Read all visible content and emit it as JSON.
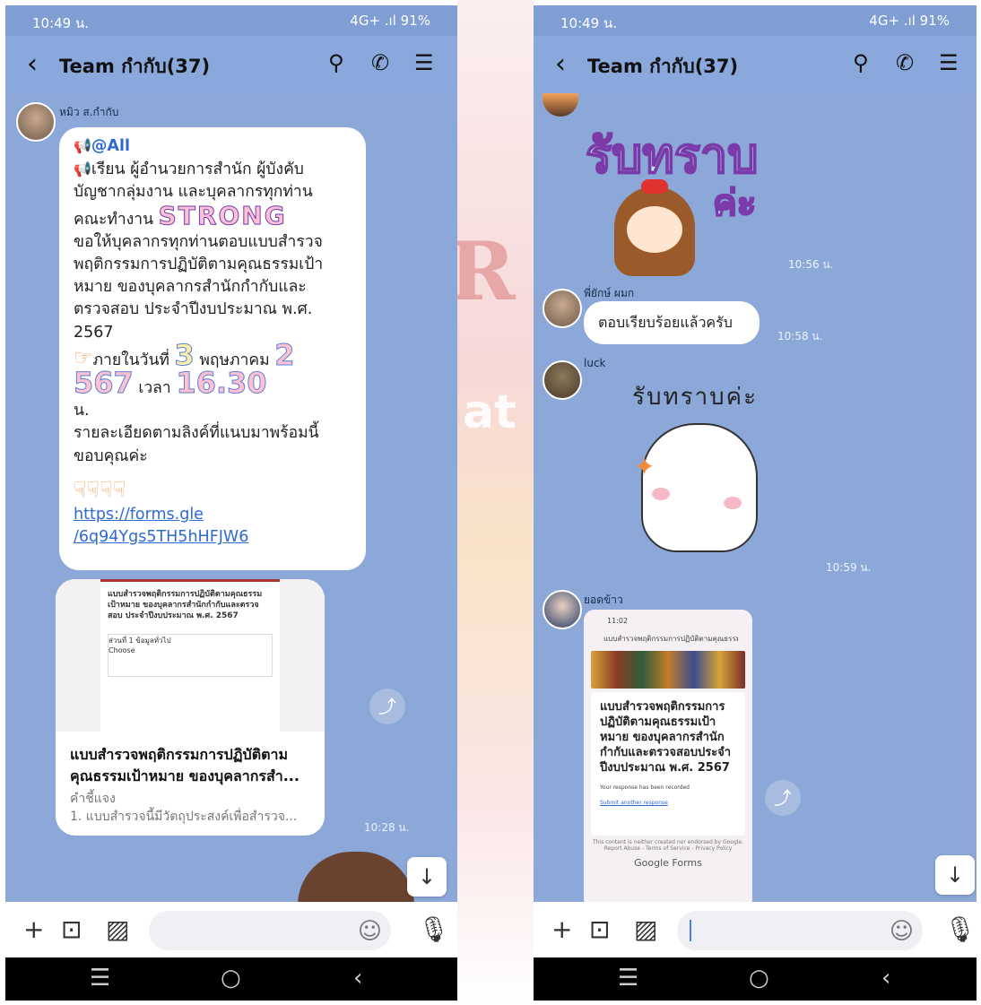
{
  "screens": [
    {
      "status": {
        "time": "10:49 น.",
        "right": "4G+ .ıl  91%"
      },
      "header": {
        "title": "Team กำกับ(37)"
      },
      "message1": {
        "sender": "หมิว ส.กำกับ",
        "mention": "@All",
        "line1": "เรียน ผู้อำนวยการสำนัก ผู้บังคับ",
        "line2": "บัญชากลุ่มงาน และบุคลากรทุกท่าน",
        "line3_prefix": "คณะทำงาน",
        "line3_strong": "STRONG",
        "line4": "ขอให้บุคลากรทุกท่านตอบแบบสำรวจ",
        "line5": "พฤติกรรมการปฏิบัติตามคุณธรรมเป้า",
        "line6": "หมาย ของบุคลากรสำนักกำกับและ",
        "line7": "ตรวจสอบ ประจำปีงบประมาณ พ.ศ.",
        "line8": "2567",
        "deadline_prefix": "ภายในวันที่",
        "deadline_day": "3",
        "deadline_month": "พฤษภาคม",
        "deadline_year1": "2",
        "deadline_year2": "567",
        "deadline_time_label": "เวลา",
        "deadline_time": "16.30",
        "deadline_unit": "น.",
        "line_detail": "รายละเอียดตามลิงค์ที่แนบมาพร้อมนี้",
        "line_thanks": "ขอบคุณค่ะ",
        "link_line1": "https://forms.gle",
        "link_line2": "/6q94Ygs5TH5hHFJW6"
      },
      "card": {
        "title_line1": "แบบสำรวจพฤติกรรมการปฏิบัติตาม",
        "title_line2": "คุณธรรมเป้าหมาย ของบุคลากรสำ...",
        "subtitle": "คำชี้แจง",
        "desc": "1. แบบสำรวจนี้มีวัตถุประสงค์เพื่อสำรวจ...",
        "time": "10:28 น.",
        "preview_title": "แบบสำรวจพฤติกรรมการปฏิบัติตามคุณธรรมเป้าหมาย ของบุคลากรสำนักกำกับและตรวจสอบ ประจำปีงบประมาณ พ.ศ. 2567",
        "preview_section": "ส่วนที่ 1 ข้อมูลทั่วไป",
        "preview_choose": "Choose"
      }
    },
    {
      "status": {
        "time": "10:49 น.",
        "right": "4G+ .ıl  91%"
      },
      "header": {
        "title": "Team กำกับ(37)"
      },
      "sticker1": {
        "word": "รับทราบ",
        "word2": "ค่ะ",
        "time": "10:56 น."
      },
      "message2": {
        "sender": "พี่ยักษ์ ผมก",
        "text": "ตอบเรียบร้อยแล้วครับ",
        "time": "10:58 น."
      },
      "sticker2": {
        "sender": "luck",
        "word": "รับทราบค่ะ",
        "time": "10:59 น."
      },
      "message3": {
        "sender": "ยอดข้าว",
        "shot_time": "11:02",
        "shot_bar": "แบบสำรวจพฤติกรรมการปฏิบัติตามคุณธรรมเป้าห...",
        "shot_title": "แบบสำรวจพฤติกรรมการปฏิบัติตามคุณธรรมเป้าหมาย ของบุคลากรสำนักกำกับและตรวจสอบประจำปีงบประมาณ พ.ศ. 2567",
        "shot_resp": "Your response has been recorded",
        "shot_submit": "Submit another response",
        "shot_foot": "This content is neither created nor endorsed by Google. Report Abuse - Terms of Service - Privacy Policy",
        "shot_gf": "Google Forms"
      }
    }
  ]
}
